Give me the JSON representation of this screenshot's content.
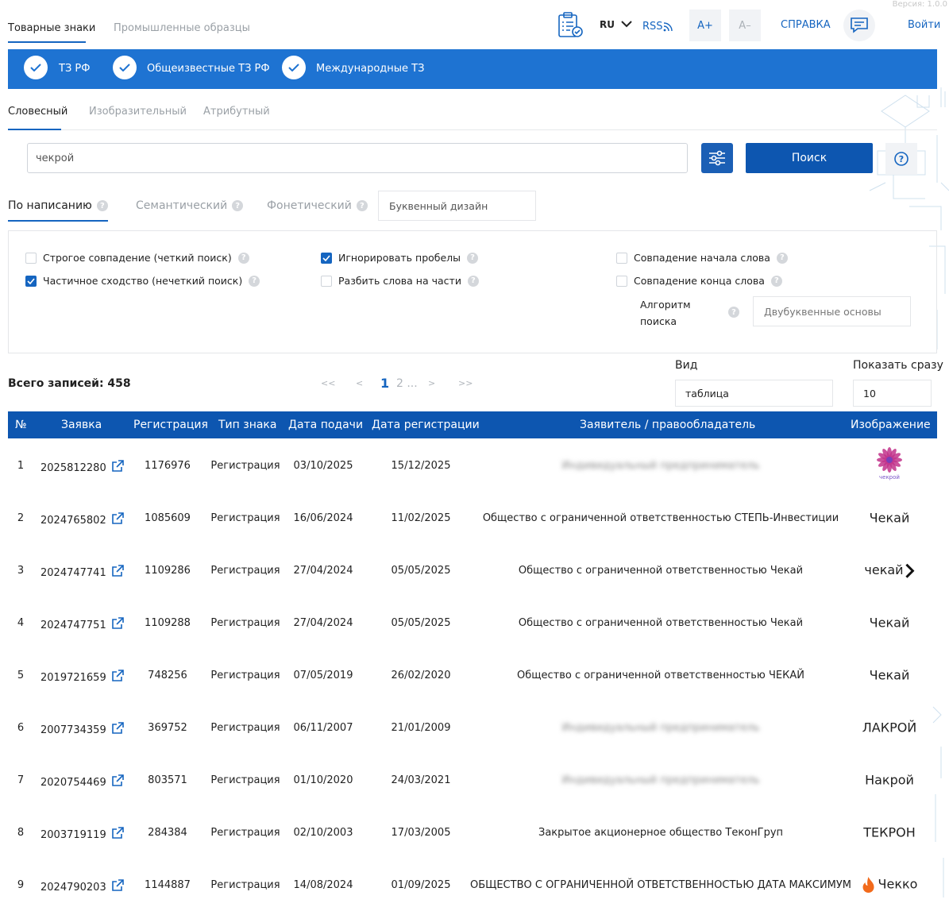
{
  "version": "Версия: 1.0.0",
  "top_tabs": [
    "Товарные знаки",
    "Промышленные образцы"
  ],
  "header": {
    "lang": "RU",
    "rss": "RSS",
    "font_up": "A+",
    "font_down": "A–",
    "help": "СПРАВКА",
    "login": "Войти"
  },
  "registers": [
    "ТЗ РФ",
    "Общеизвестные ТЗ РФ",
    "Международные ТЗ"
  ],
  "search_tabs": [
    "Словесный",
    "Изобразительный",
    "Атрибутный"
  ],
  "search": {
    "value": "чекрой",
    "button": "Поиск"
  },
  "modes": [
    "По написанию",
    "Семантический",
    "Фонетический"
  ],
  "letter_design_placeholder": "Буквенный дизайн",
  "options": {
    "strict": "Строгое совпадение (четкий поиск)",
    "partial": "Частичное сходство (нечеткий поиск)",
    "ignore_spaces": "Игнорировать пробелы",
    "split_words": "Разбить слова на части",
    "word_start": "Совпадение начала слова",
    "word_end": "Совпадение конца слова",
    "algorithm_label": "Алгоритм поиска",
    "algorithm_value": "Двубуквенные основы",
    "checked": {
      "strict": false,
      "partial": true,
      "ignore_spaces": true,
      "split_words": false,
      "word_start": false,
      "word_end": false
    }
  },
  "results": {
    "total": "Всего записей: 458",
    "pager": {
      "first": "<<",
      "prev": "<",
      "current": "1",
      "next_page": "2 ...",
      "next": ">",
      "last": ">>"
    },
    "view_label": "Вид",
    "view_value": "таблица",
    "show_label": "Показать сразу",
    "show_value": "10"
  },
  "table": {
    "columns": [
      "№",
      "Заявка",
      "Регистрация",
      "Тип знака",
      "Дата подачи",
      "Дата регистрации",
      "Заявитель / правообладатель",
      "Изображение"
    ],
    "rows": [
      {
        "n": "1",
        "app": "2025812280",
        "reg": "1176976",
        "type": "Регистрация",
        "filed": "03/10/2025",
        "regdate": "15/12/2025",
        "owner": "Индивидуальный предприниматель",
        "blur": true,
        "logo": "чекрой"
      },
      {
        "n": "2",
        "app": "2024765802",
        "reg": "1085609",
        "type": "Регистрация",
        "filed": "16/06/2024",
        "regdate": "11/02/2025",
        "owner": "Общество с ограниченной ответственностью СТЕПЬ-Инвестиции",
        "blur": false,
        "logo": "Чекай"
      },
      {
        "n": "3",
        "app": "2024747741",
        "reg": "1109286",
        "type": "Регистрация",
        "filed": "27/04/2024",
        "regdate": "05/05/2025",
        "owner": "Общество с ограниченной ответственностью Чекай",
        "blur": false,
        "logo": "чекай"
      },
      {
        "n": "4",
        "app": "2024747751",
        "reg": "1109288",
        "type": "Регистрация",
        "filed": "27/04/2024",
        "regdate": "05/05/2025",
        "owner": "Общество с ограниченной ответственностью Чекай",
        "blur": false,
        "logo": "Чекай"
      },
      {
        "n": "5",
        "app": "2019721659",
        "reg": "748256",
        "type": "Регистрация",
        "filed": "07/05/2019",
        "regdate": "26/02/2020",
        "owner": "Общество с ограниченной ответственностью ЧЕКАЙ",
        "blur": false,
        "logo": "Чекай"
      },
      {
        "n": "6",
        "app": "2007734359",
        "reg": "369752",
        "type": "Регистрация",
        "filed": "06/11/2007",
        "regdate": "21/01/2009",
        "owner": "Индивидуальный предприниматель",
        "blur": true,
        "logo": "ЛАКРОЙ"
      },
      {
        "n": "7",
        "app": "2020754469",
        "reg": "803571",
        "type": "Регистрация",
        "filed": "01/10/2020",
        "regdate": "24/03/2021",
        "owner": "Индивидуальный предприниматель",
        "blur": true,
        "logo": "Накрой"
      },
      {
        "n": "8",
        "app": "2003719119",
        "reg": "284384",
        "type": "Регистрация",
        "filed": "02/10/2003",
        "regdate": "17/03/2005",
        "owner": "Закрытое акционерное общество ТеконГруп",
        "blur": false,
        "logo": "ТЕКРОН"
      },
      {
        "n": "9",
        "app": "2024790203",
        "reg": "1144887",
        "type": "Регистрация",
        "filed": "14/08/2024",
        "regdate": "01/09/2025",
        "owner": "ОБЩЕСТВО С ОГРАНИЧЕННОЙ ОТВЕТСТВЕННОСТЬЮ ДАТА МАКСИМУМ",
        "blur": false,
        "logo": "Чекко"
      }
    ]
  },
  "colors": {
    "primary": "#1e73d2",
    "dark_primary": "#0d56b0",
    "link": "#1565c0"
  }
}
